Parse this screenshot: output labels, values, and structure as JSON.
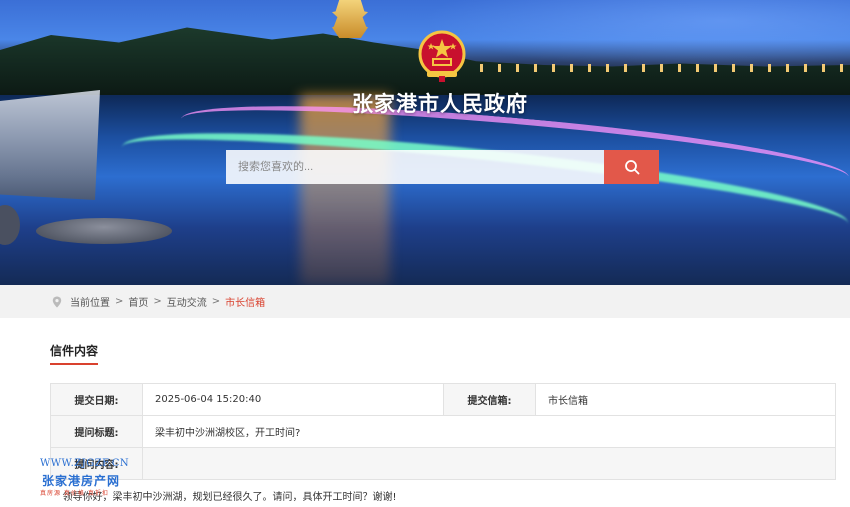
{
  "header": {
    "site_title": "张家港市人民政府",
    "search_placeholder": "搜索您喜欢的..."
  },
  "breadcrumb": {
    "prefix": "当前位置",
    "items": [
      "首页",
      "互动交流",
      "市长信箱"
    ],
    "separator": ">"
  },
  "section": {
    "title": "信件内容"
  },
  "letter": {
    "submit_date_label": "提交日期:",
    "submit_date_value": "2025-06-04 15:20:40",
    "mailbox_label": "提交信箱:",
    "mailbox_value": "市长信箱",
    "subject_label": "提问标题:",
    "subject_value": "梁丰初中沙洲湖校区，开工时间?",
    "content_label": "提问内容:",
    "content_value": "领导你好，梁丰初中沙洲湖，规划已经很久了。请问，具体开工时间？谢谢!"
  },
  "watermark": {
    "url": "WWW.ZJGZF.CN",
    "name": "张家港房产网",
    "subtitle": "真房源 真价格 真折扣"
  },
  "colors": {
    "accent": "#d9412e",
    "search_button": "#e2584a",
    "breadcrumb_bg": "#f2f2f2"
  }
}
